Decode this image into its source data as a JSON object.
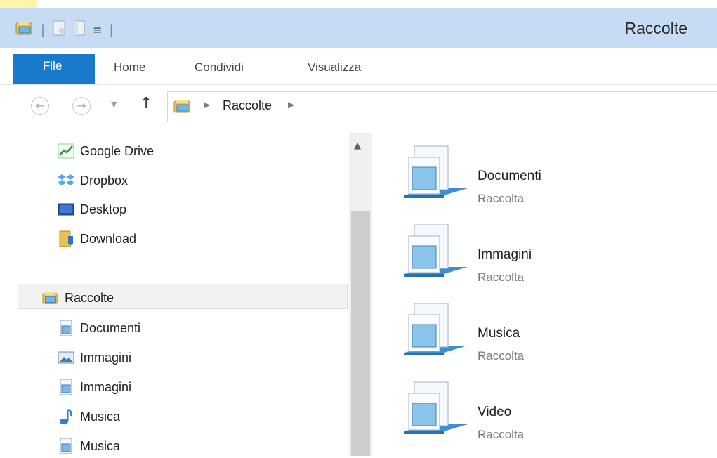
{
  "window": {
    "title": "Raccolte"
  },
  "ribbon": {
    "tabs": [
      {
        "label": "File"
      },
      {
        "label": "Home"
      },
      {
        "label": "Condividi"
      },
      {
        "label": "Visualizza"
      }
    ]
  },
  "address": {
    "path": [
      "Raccolte"
    ]
  },
  "nav_pane": {
    "favorites": [
      {
        "label": "Google Drive",
        "icon": "google-drive-icon"
      },
      {
        "label": "Dropbox",
        "icon": "dropbox-icon"
      },
      {
        "label": "Desktop",
        "icon": "desktop-icon"
      },
      {
        "label": "Download",
        "icon": "download-folder-icon"
      }
    ],
    "libraries_header": {
      "label": "Raccolte",
      "icon": "libraries-icon"
    },
    "libraries": [
      {
        "label": "Documenti",
        "icon": "document-library-icon"
      },
      {
        "label": "Immagini",
        "icon": "picture-icon"
      },
      {
        "label": "Immagini",
        "icon": "document-library-icon"
      },
      {
        "label": "Musica",
        "icon": "music-note-icon"
      },
      {
        "label": "Musica",
        "icon": "document-library-icon"
      }
    ]
  },
  "content": {
    "items": [
      {
        "name": "Documenti",
        "type": "Raccolta"
      },
      {
        "name": "Immagini",
        "type": "Raccolta"
      },
      {
        "name": "Musica",
        "type": "Raccolta"
      },
      {
        "name": "Video",
        "type": "Raccolta"
      }
    ]
  },
  "colors": {
    "titlebar": "#c6dbf4",
    "file_tab": "#1979ca",
    "secondary_text": "#7a7a7a"
  }
}
